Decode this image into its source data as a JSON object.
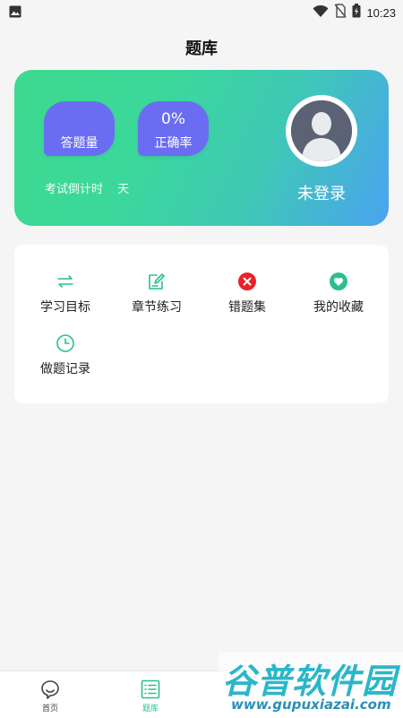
{
  "status_bar": {
    "time": "10:23",
    "icons": [
      "image-icon",
      "wifi-icon",
      "no-sim-icon",
      "battery-charging-icon"
    ]
  },
  "page": {
    "title": "题库"
  },
  "hero": {
    "answered": {
      "value": "",
      "label": "答题量"
    },
    "accuracy": {
      "value": "0%",
      "label": "正确率"
    },
    "countdown": {
      "prefix": "考试倒计时",
      "days": "",
      "unit": "天"
    },
    "login_text": "未登录",
    "avatar_icon": "user-avatar-icon"
  },
  "menu": {
    "items": [
      {
        "label": "学习目标",
        "icon": "repeat-arrows-icon"
      },
      {
        "label": "章节练习",
        "icon": "edit-note-icon"
      },
      {
        "label": "错题集",
        "icon": "close-circle-icon"
      },
      {
        "label": "我的收藏",
        "icon": "heart-circle-icon"
      },
      {
        "label": "做题记录",
        "icon": "clock-icon"
      }
    ]
  },
  "bottom_nav": {
    "items": [
      {
        "label": "首页",
        "icon": "home-chat-icon"
      },
      {
        "label": "题库",
        "icon": "list-icon"
      }
    ]
  },
  "watermark": {
    "title": "谷普软件园",
    "url": "www.gupuxiazai.com"
  },
  "colors": {
    "accent": "#2bbf8c",
    "bubble": "#6a6df2",
    "error": "#e8222a",
    "gradient_start": "#3ed98f",
    "gradient_end": "#4aa3f0"
  }
}
